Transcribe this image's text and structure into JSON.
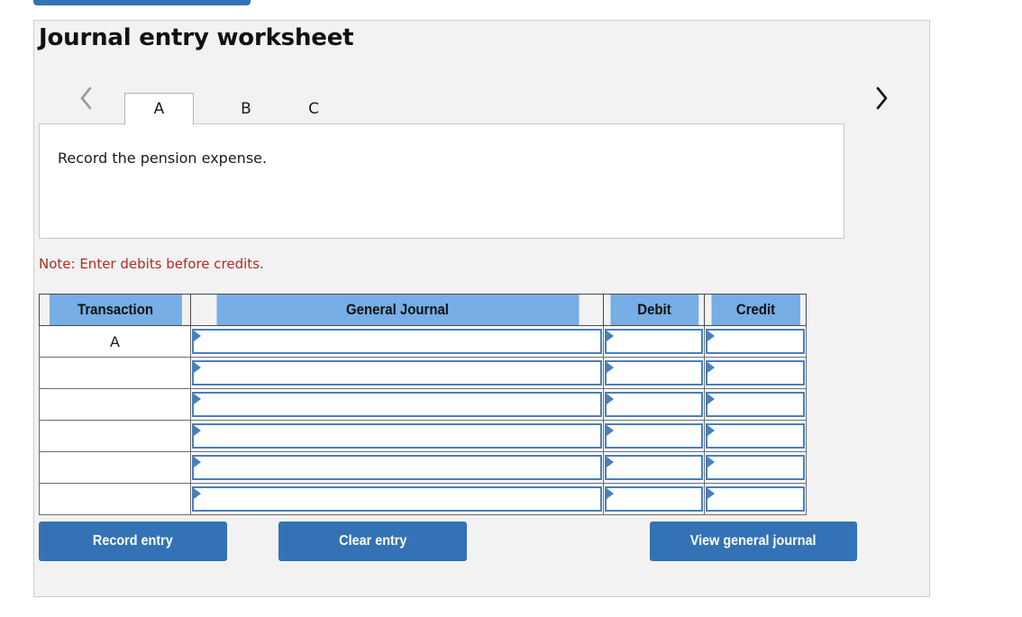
{
  "title": "Journal entry worksheet",
  "nav": {
    "prev_icon": "chevron-left-icon",
    "next_icon": "chevron-right-icon"
  },
  "tabs": [
    {
      "label": "A",
      "active": true
    },
    {
      "label": "B",
      "active": false
    },
    {
      "label": "C",
      "active": false
    }
  ],
  "description": "Record the pension expense.",
  "note": "Note: Enter debits before credits.",
  "table": {
    "columns": [
      "Transaction",
      "General Journal",
      "Debit",
      "Credit"
    ],
    "rows": [
      {
        "transaction": "A",
        "general_journal": "",
        "debit": "",
        "credit": ""
      },
      {
        "transaction": "",
        "general_journal": "",
        "debit": "",
        "credit": ""
      },
      {
        "transaction": "",
        "general_journal": "",
        "debit": "",
        "credit": ""
      },
      {
        "transaction": "",
        "general_journal": "",
        "debit": "",
        "credit": ""
      },
      {
        "transaction": "",
        "general_journal": "",
        "debit": "",
        "credit": ""
      },
      {
        "transaction": "",
        "general_journal": "",
        "debit": "",
        "credit": ""
      }
    ]
  },
  "buttons": {
    "record": "Record entry",
    "clear": "Clear entry",
    "view": "View general journal"
  },
  "colors": {
    "button_blue": "#3372b5",
    "header_blue": "#76aee5",
    "input_border_blue": "#4a7fb8",
    "note_red": "#b02a2a",
    "panel_gray": "#f2f2f2"
  }
}
